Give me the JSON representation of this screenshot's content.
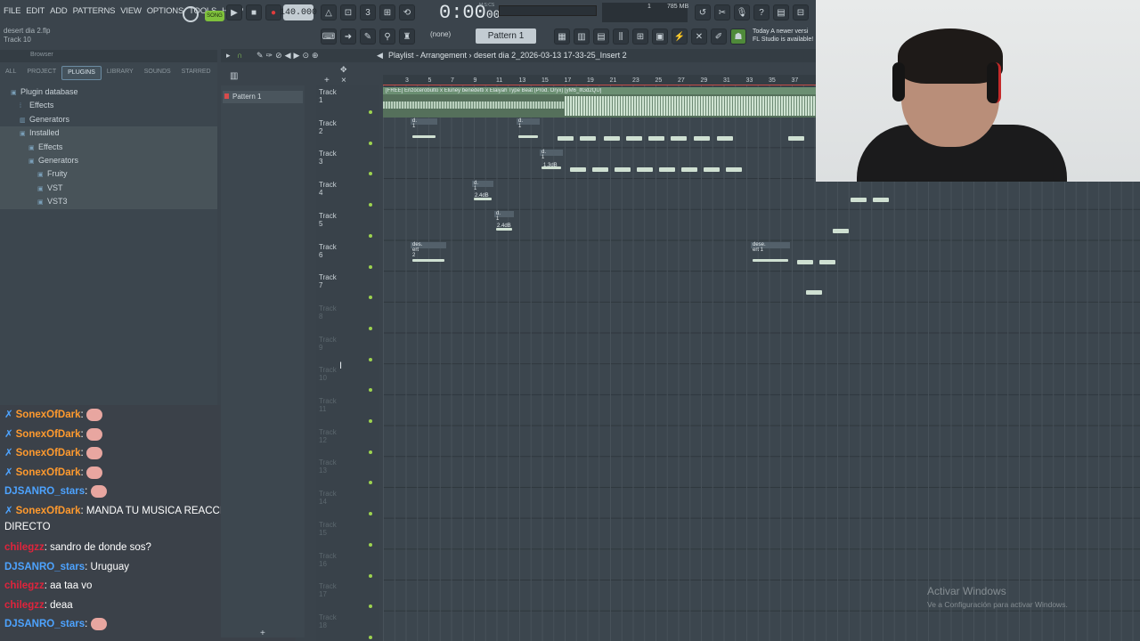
{
  "menu": [
    "FILE",
    "EDIT",
    "ADD",
    "PATTERNS",
    "VIEW",
    "OPTIONS",
    "TOOLS",
    "HELP"
  ],
  "hint": {
    "file": "desert dia 2.flp",
    "track": "Track 10"
  },
  "transport": {
    "song_label": "SONG",
    "tempo": "140.000",
    "time": "0:00",
    "time_small": "00",
    "time_unit_label": "M:S:CS",
    "mem_value": "1",
    "mem_label": "785 MB"
  },
  "toolbar2": {
    "none_label": "(none)",
    "pattern_label": "Pattern 1",
    "newver_line1": "Today  A newer versi",
    "newver_line2": "FL Studio is available!"
  },
  "browser": {
    "header": "Browser",
    "tabs": [
      "ALL",
      "PROJECT",
      "PLUGINS",
      "LIBRARY",
      "SOUNDS",
      "STARRED"
    ],
    "selected_tab": "PLUGINS",
    "tree": [
      {
        "label": "Plugin database"
      },
      {
        "label": "Effects"
      },
      {
        "label": "Generators"
      },
      {
        "label": "Installed"
      },
      {
        "label": "Effects"
      },
      {
        "label": "Generators"
      },
      {
        "label": "Fruity"
      },
      {
        "label": "VST"
      },
      {
        "label": "VST3"
      }
    ]
  },
  "chat": [
    {
      "user": "SonexOfDark",
      "color": "#ff9a2e",
      "text": "",
      "badge": true
    },
    {
      "user": "SonexOfDark",
      "color": "#ff9a2e",
      "text": "",
      "badge": true
    },
    {
      "user": "SonexOfDark",
      "color": "#ff9a2e",
      "text": "",
      "badge": true
    },
    {
      "user": "SonexOfDark",
      "color": "#ff9a2e",
      "text": "",
      "badge": true
    },
    {
      "user": "DJSANRO_stars",
      "color": "#4da3ff",
      "text": "",
      "badge": false
    },
    {
      "user": "SonexOfDark",
      "color": "#ff9a2e",
      "text": "MANDA TU MUSICA REACCIONA EN DIRECTO",
      "badge": true
    },
    {
      "user": "chilegzz",
      "color": "#e0243c",
      "text": "sandro de donde sos?",
      "badge": false
    },
    {
      "user": "DJSANRO_stars",
      "color": "#4da3ff",
      "text": "Uruguay",
      "badge": false
    },
    {
      "user": "chilegzz",
      "color": "#e0243c",
      "text": "aa taa vo",
      "badge": false
    },
    {
      "user": "chilegzz",
      "color": "#e0243c",
      "text": "deaa",
      "badge": false
    },
    {
      "user": "DJSANRO_stars",
      "color": "#4da3ff",
      "text": "",
      "badge": false
    }
  ],
  "pattern_panel": {
    "item": "Pattern 1"
  },
  "playlist": {
    "title": "Playlist - Arrangement",
    "crumb": "desert dia 2_2026-03-13 17-33-25_Insert 2",
    "ruler": [
      "3",
      "5",
      "7",
      "9",
      "11",
      "13",
      "15",
      "17",
      "19",
      "21",
      "23",
      "25",
      "27",
      "29",
      "31",
      "33",
      "35",
      "37"
    ],
    "tracks": [
      "Track 1",
      "Track 2",
      "Track 3",
      "Track 4",
      "Track 5",
      "Track 6",
      "Track 7",
      "Track 8",
      "Track 9",
      "Track 10",
      "Track 11",
      "Track 12",
      "Track 13",
      "Track 14",
      "Track 15",
      "Track 16",
      "Track 17",
      "Track 18"
    ],
    "main_clip_label": "[FREE] Enzocerobulto x Eluney benedetti x Elaiyah Type Beat (Prod. Oryx) [yM6_lfGd2QU]",
    "clip_labels": [
      "d. 1",
      "d. 1",
      "d. 1",
      "d. 1",
      "des. ert 2",
      "dese. ert 1"
    ],
    "db_labels": [
      "1.3dB",
      "2.4dB",
      "2.4dB"
    ]
  },
  "watermark": {
    "line1": "Activar Windows",
    "line2": "Ve a Configuración para activar Windows."
  }
}
